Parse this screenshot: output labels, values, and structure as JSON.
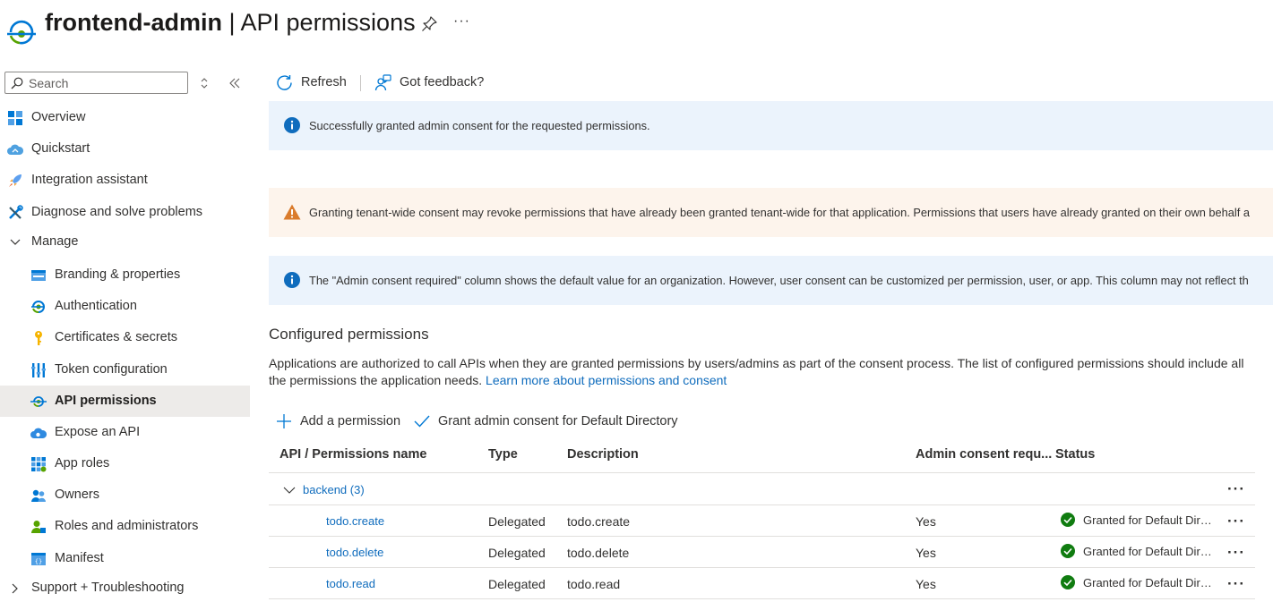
{
  "header": {
    "app_name": "frontend-admin",
    "separator": " | ",
    "page_name": "API permissions",
    "more_label": "···"
  },
  "sidebar": {
    "search_placeholder": "Search",
    "items": [
      {
        "label": "Overview",
        "icon": "overview-grid-icon"
      },
      {
        "label": "Quickstart",
        "icon": "quickstart-cloud-icon"
      },
      {
        "label": "Integration assistant",
        "icon": "rocket-icon"
      },
      {
        "label": "Diagnose and solve problems",
        "icon": "wrench-icon"
      },
      {
        "label": "Manage",
        "icon": "chevron-down-icon"
      },
      {
        "label": "Branding & properties",
        "icon": "branding-icon"
      },
      {
        "label": "Authentication",
        "icon": "authentication-icon"
      },
      {
        "label": "Certificates & secrets",
        "icon": "key-icon"
      },
      {
        "label": "Token configuration",
        "icon": "token-bars-icon"
      },
      {
        "label": "API permissions",
        "icon": "api-permissions-icon"
      },
      {
        "label": "Expose an API",
        "icon": "cloud-expose-icon"
      },
      {
        "label": "App roles",
        "icon": "app-roles-icon"
      },
      {
        "label": "Owners",
        "icon": "owners-icon"
      },
      {
        "label": "Roles and administrators",
        "icon": "roles-admin-icon"
      },
      {
        "label": "Manifest",
        "icon": "manifest-icon"
      },
      {
        "label": "Support + Troubleshooting",
        "icon": "chevron-right-icon"
      }
    ]
  },
  "toolbar": {
    "refresh_label": "Refresh",
    "feedback_label": "Got feedback?"
  },
  "banners": {
    "success": "Successfully granted admin consent for the requested permissions.",
    "warning": "Granting tenant-wide consent may revoke permissions that have already been granted tenant-wide for that application. Permissions that users have already granted on their own behalf a",
    "info": "The \"Admin consent required\" column shows the default value for an organization. However, user consent can be customized per permission, user, or app. This column may not reflect th"
  },
  "configured": {
    "title": "Configured permissions",
    "description": "Applications are authorized to call APIs when they are granted permissions by users/admins as part of the consent process. The list of configured permissions should include all the permissions the application needs. ",
    "learn_more": "Learn more about permissions and consent",
    "add_permission": "Add a permission",
    "grant_consent": "Grant admin consent for Default Directory"
  },
  "table": {
    "headers": {
      "name": "API / Permissions name",
      "type": "Type",
      "description": "Description",
      "admin": "Admin consent requ...",
      "status": "Status"
    },
    "group": {
      "label": "backend (3)"
    },
    "rows": [
      {
        "name": "todo.create",
        "type": "Delegated",
        "description": "todo.create",
        "admin": "Yes",
        "status": "Granted for Default Directory"
      },
      {
        "name": "todo.delete",
        "type": "Delegated",
        "description": "todo.delete",
        "admin": "Yes",
        "status": "Granted for Default Directory"
      },
      {
        "name": "todo.read",
        "type": "Delegated",
        "description": "todo.read",
        "admin": "Yes",
        "status": "Granted for Default Directory"
      }
    ],
    "more_label": "···"
  },
  "colors": {
    "link": "#0f6cbd",
    "info_bg": "#ebf3fc",
    "warning_bg": "#fdf4ec",
    "warning_icon": "#da7b2c",
    "success": "#107c10",
    "active_nav_bg": "#edebe9"
  }
}
